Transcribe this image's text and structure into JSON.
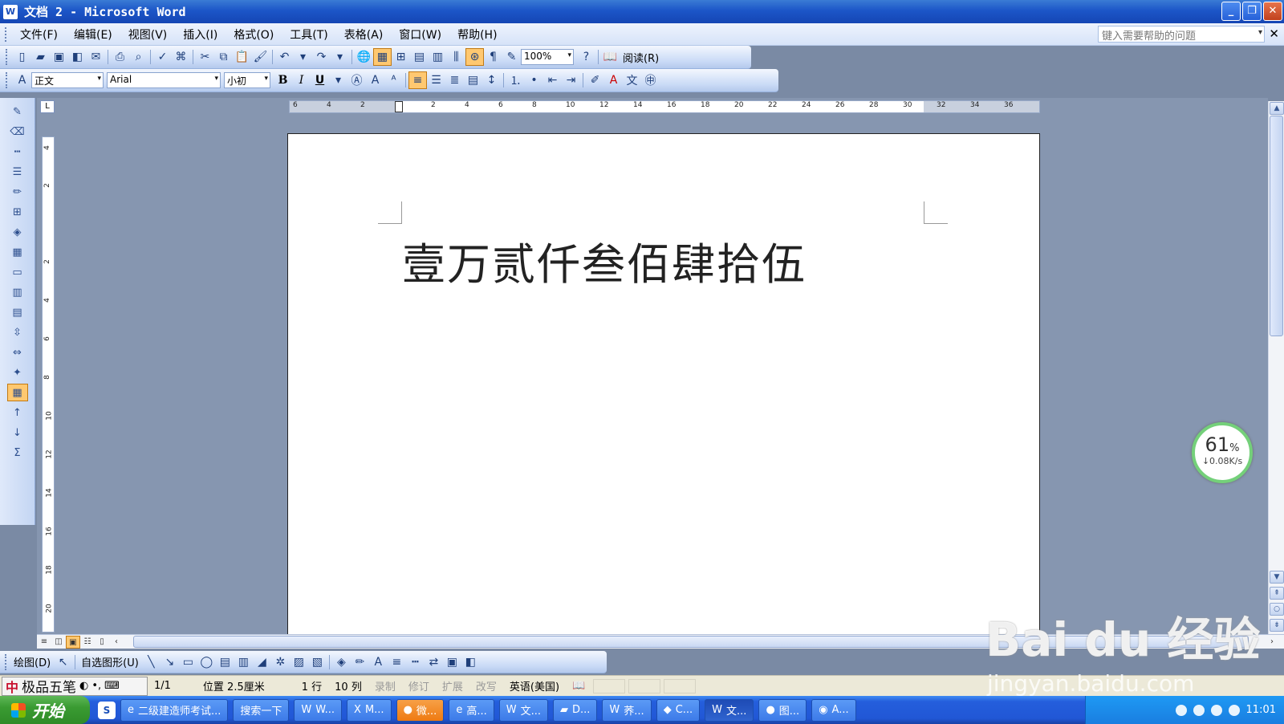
{
  "window": {
    "title": "文档 2 - Microsoft Word",
    "buttons": [
      "minimize",
      "restore",
      "close"
    ]
  },
  "menubar": {
    "items": [
      "文件(F)",
      "编辑(E)",
      "视图(V)",
      "插入(I)",
      "格式(O)",
      "工具(T)",
      "表格(A)",
      "窗口(W)",
      "帮助(H)"
    ],
    "help_placeholder": "键入需要帮助的问题"
  },
  "toolbar_standard": {
    "zoom": "100%",
    "reading_label": "阅读(R)"
  },
  "toolbar_format": {
    "style": "正文",
    "font": "Arial",
    "size": "小初",
    "bold": "B",
    "italic": "I",
    "underline": "U"
  },
  "ruler": {
    "h_numbers": [
      "6",
      "4",
      "2",
      "2",
      "4",
      "6",
      "8",
      "10",
      "12",
      "14",
      "16",
      "18",
      "20",
      "22",
      "24",
      "26",
      "28",
      "30",
      "32",
      "34",
      "36"
    ],
    "v_numbers": [
      "4",
      "2",
      "2",
      "4",
      "6",
      "8",
      "10",
      "12",
      "14",
      "16",
      "18",
      "20"
    ],
    "corner": "L"
  },
  "document": {
    "text": "壹万贰仟叁佰肆拾伍"
  },
  "drawing_toolbar": {
    "draw_label": "绘图(D)",
    "autoshape_label": "自选图形(U)"
  },
  "statusbar": {
    "ime_name": "极品五笔",
    "page": "1/1",
    "position": "位置 2.5厘米",
    "line": "1 行",
    "col": "10 列",
    "rec": "录制",
    "trk": "修订",
    "ext": "扩展",
    "ovr": "改写",
    "lang": "英语(美国)"
  },
  "taskbar": {
    "start": "开始",
    "tasks": [
      "二级建造师考试...",
      "搜索一下",
      "W...",
      "M...",
      "微...",
      "高...",
      "文...",
      "D...",
      "荞...",
      "C...",
      "文...",
      "图...",
      "A..."
    ],
    "time": "11:01"
  },
  "net_widget": {
    "percent": "61",
    "unit": "%",
    "speed": "↓0.08K/s"
  },
  "watermark": {
    "brand": "Bai du 经验",
    "url": "jingyan.baidu.com"
  }
}
